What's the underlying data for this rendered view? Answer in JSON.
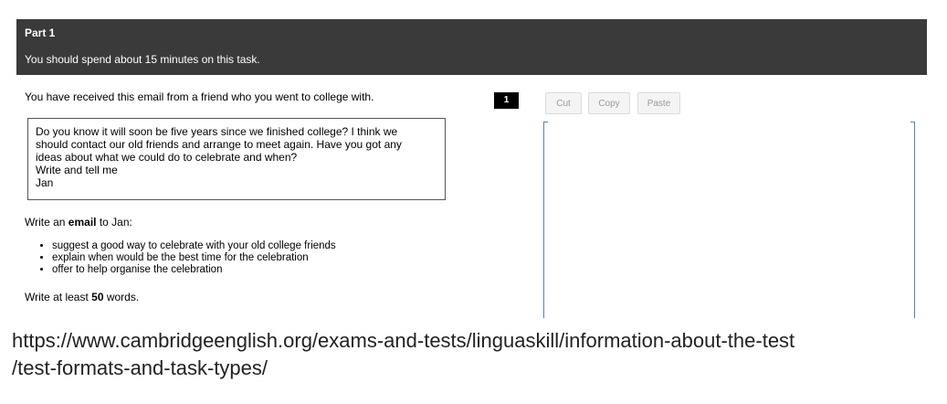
{
  "header": {
    "part": "Part 1",
    "instruction": "You should spend about 15 minutes on this task."
  },
  "task": {
    "intro": "You have received this email from a friend who you went to college with.",
    "email_lines": [
      "Do you know it will soon be five years since we finished college? I think we",
      "should contact our old friends and arrange to meet again. Have you got any",
      "ideas about what we could do to celebrate and when?",
      "Write and tell me",
      "Jan"
    ],
    "write_prefix": "Write an ",
    "write_bold": "email",
    "write_suffix": " to Jan:",
    "bullets": [
      "suggest a good way to celebrate with your old college friends",
      "explain when would be the best time for the celebration",
      "offer to help organise the celebration"
    ],
    "least_prefix": "Write at least ",
    "least_bold": "50",
    "least_suffix": " words."
  },
  "answer": {
    "question_number": "1",
    "toolbar": {
      "cut": "Cut",
      "copy": "Copy",
      "paste": "Paste"
    }
  },
  "caption": {
    "url_line1": "https://www.cambridgeenglish.org/exams-and-tests/linguaskill/information-about-the-test",
    "url_line2": "/test-formats-and-task-types/"
  }
}
